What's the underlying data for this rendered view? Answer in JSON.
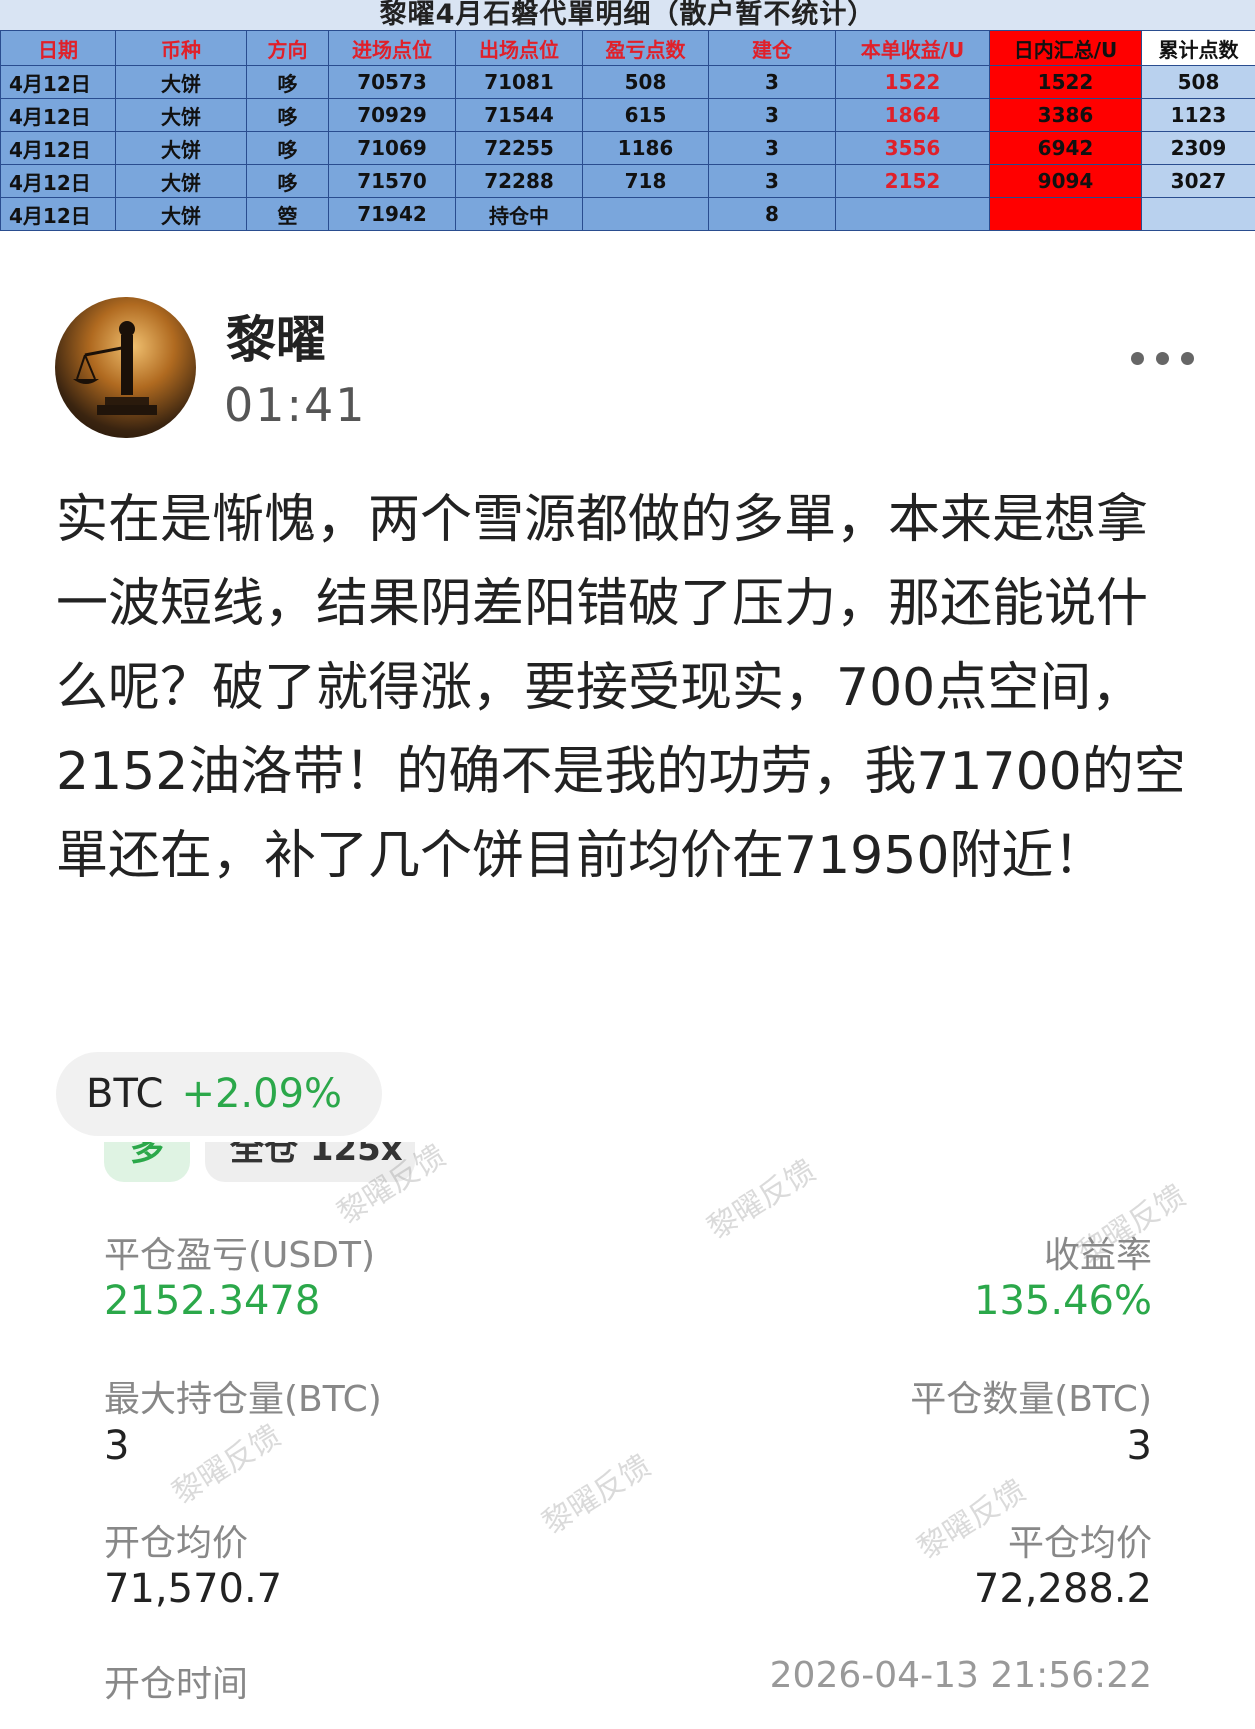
{
  "sheet": {
    "title": "黎曜4月石磐代單明细（散户暂不统计）",
    "headers": [
      "日期",
      "币种",
      "方向",
      "进场点位",
      "出场点位",
      "盈亏点数",
      "建仓",
      "本单收益/U",
      "日内汇总/U",
      "累计点数"
    ],
    "rows": [
      [
        "4月12日",
        "大饼",
        "哆",
        "70573",
        "71081",
        "508",
        "3",
        "1522",
        "1522",
        "508"
      ],
      [
        "4月12日",
        "大饼",
        "哆",
        "70929",
        "71544",
        "615",
        "3",
        "1864",
        "3386",
        "1123"
      ],
      [
        "4月12日",
        "大饼",
        "哆",
        "71069",
        "72255",
        "1186",
        "3",
        "3556",
        "6942",
        "2309"
      ],
      [
        "4月12日",
        "大饼",
        "哆",
        "71570",
        "72288",
        "718",
        "3",
        "2152",
        "9094",
        "3027"
      ],
      [
        "4月12日",
        "大饼",
        "箜",
        "71942",
        "持仓中",
        "",
        "8",
        "",
        "",
        ""
      ]
    ]
  },
  "post": {
    "author": "黎曜",
    "time": "01:41",
    "text": "实在是惭愧，两个雪源都做的多單，本来是想拿一波短线，结果阴差阳错破了压力，那还能说什么呢？破了就得涨，要接受现实，700点空间，2152油洛带！的确不是我的功劳，我71700的空單还在，补了几个饼目前均价在71950附近！"
  },
  "coin": {
    "symbol": "BTC",
    "change": "+2.09%"
  },
  "trade": {
    "side": "多",
    "mode": "全仓 125x",
    "pnl_label": "平仓盈亏(USDT)",
    "pnl_value": "2152.3478",
    "roi_label": "收益率",
    "roi_value": "135.46%",
    "max_pos_label": "最大持仓量(BTC)",
    "max_pos_value": "3",
    "close_qty_label": "平仓数量(BTC)",
    "close_qty_value": "3",
    "open_avg_label": "开仓均价",
    "open_avg_value": "71,570.7",
    "close_avg_label": "平仓均价",
    "close_avg_value": "72,288.2",
    "open_time_label": "开仓时间",
    "open_time_value": "2026-04-13 21:56:22"
  },
  "watermark": "黎曜反馈",
  "colors": {
    "green": "#2ba84a",
    "red": "#ff0000",
    "sheet_blue": "#7aa6dc"
  }
}
